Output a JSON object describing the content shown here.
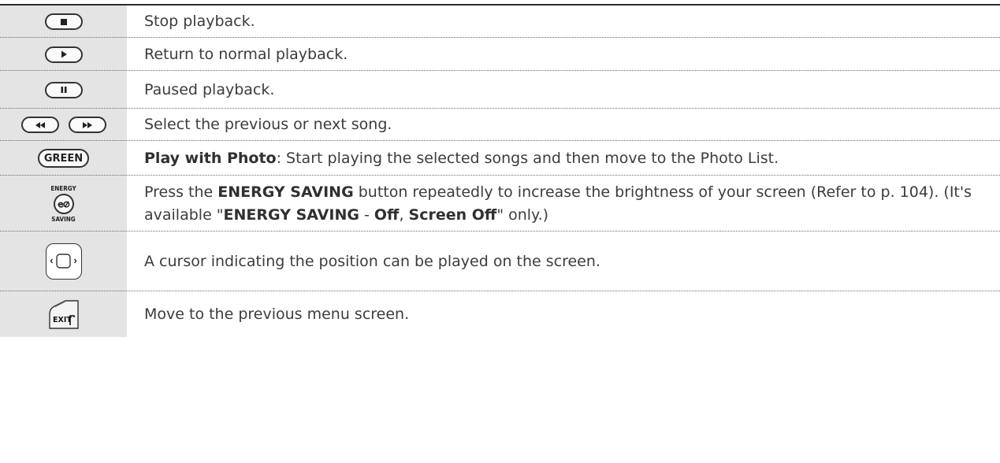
{
  "rows": [
    {
      "icon": "stop-button-icon",
      "text": "Stop playback."
    },
    {
      "icon": "play-button-icon",
      "text": "Return to normal playback."
    },
    {
      "icon": "pause-button-icon",
      "text": "Paused playback."
    },
    {
      "icon": "rewind-fastforward-buttons-icon",
      "text": "Select the previous or next song."
    },
    {
      "icon": "green-button-icon",
      "icon_label": "GREEN",
      "bold": "Play with Photo",
      "text": ": Start playing the selected songs and then move to the Photo List."
    },
    {
      "icon": "energy-saving-button-icon",
      "icon_top": "ENERGY",
      "icon_bottom": "SAVING",
      "t1": "Press the ",
      "b1": "ENERGY SAVING",
      "t2": " button repeatedly to increase the brightness of your screen (Refer to p. 104). (It's available \"",
      "b2": "ENERGY SAVING",
      "t3": " - ",
      "b3": "Off",
      "t4": ", ",
      "b4": "Screen Off",
      "t5": "\" only.)"
    },
    {
      "icon": "navigation-pad-icon",
      "text": "A cursor indicating the position can be played on the screen."
    },
    {
      "icon": "exit-button-icon",
      "icon_label": "EXIT",
      "text": "Move to the previous menu screen."
    }
  ]
}
